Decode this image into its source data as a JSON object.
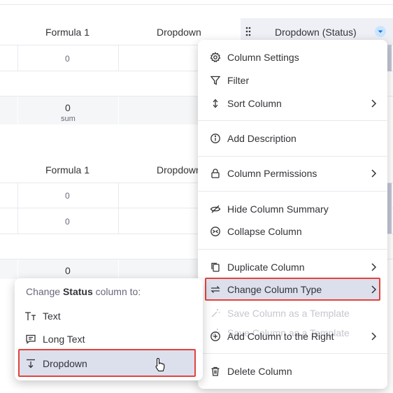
{
  "table": {
    "group1": {
      "headers": {
        "formula": "Formula 1",
        "dropdown": "Dropdown",
        "dropdown_status": "Dropdown (Status)"
      },
      "row_values": [
        "0"
      ],
      "summary": {
        "value": "0",
        "label": "sum"
      }
    },
    "group2": {
      "headers": {
        "formula": "Formula 1",
        "dropdown": "Dropdown"
      },
      "row_values": [
        "0",
        "0"
      ],
      "summary": {
        "value": "0"
      }
    }
  },
  "column_menu": {
    "items": [
      {
        "label": "Column Settings",
        "icon": "gear-icon"
      },
      {
        "label": "Filter",
        "icon": "filter-icon"
      },
      {
        "label": "Sort Column",
        "icon": "sort-icon",
        "submenu": true
      },
      {
        "label": "Add Description",
        "icon": "info-icon"
      },
      {
        "label": "Column Permissions",
        "icon": "lock-icon",
        "submenu": true
      },
      {
        "label": "Hide Column Summary",
        "icon": "eye-off-icon"
      },
      {
        "label": "Collapse Column",
        "icon": "collapse-icon"
      },
      {
        "label": "Duplicate Column",
        "icon": "duplicate-icon",
        "submenu": true
      },
      {
        "label": "Change Column Type",
        "icon": "swap-icon",
        "submenu": true,
        "highlighted": true
      },
      {
        "label": "Save Column as a Template",
        "icon": "magic-icon",
        "disabled": true
      },
      {
        "label": "Add Column to the Right",
        "icon": "plus-circle-icon",
        "submenu": true
      },
      {
        "label": "Delete Column",
        "icon": "trash-icon"
      }
    ]
  },
  "type_submenu": {
    "title_prefix": "Change ",
    "title_bold": "Status",
    "title_suffix": " column to:",
    "items": [
      {
        "label": "Text",
        "icon": "text-type-icon"
      },
      {
        "label": "Long Text",
        "icon": "long-text-icon"
      },
      {
        "label": "Dropdown",
        "icon": "dropdown-type-icon",
        "highlighted": true
      }
    ]
  },
  "colors": {
    "accent": "#0073ea",
    "highlight_border": "#e2443c",
    "highlight_bg": "#dcdfec",
    "disabled": "#c5c7d0"
  }
}
